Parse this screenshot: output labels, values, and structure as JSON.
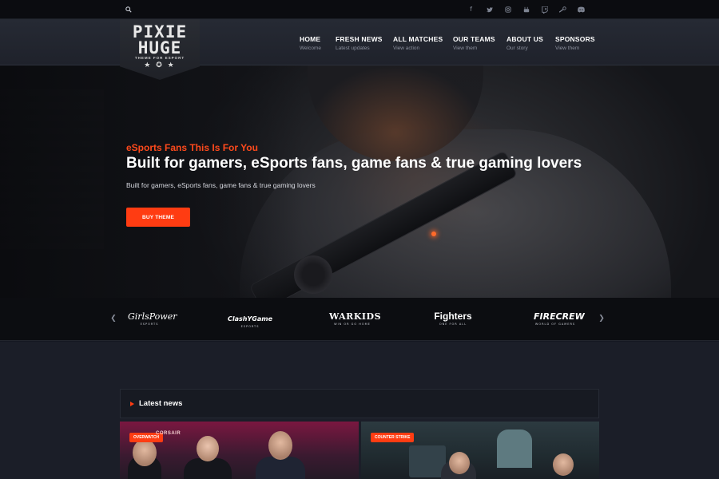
{
  "social": [
    "facebook-icon",
    "twitter-icon",
    "instagram-icon",
    "youtube-icon",
    "twitch-icon",
    "steam-icon",
    "discord-icon"
  ],
  "logo": {
    "line1": "PIXIE",
    "line2": "HUGE",
    "tagline": "THEME FOR ESPORT"
  },
  "nav": [
    {
      "label": "HOME",
      "sub": "Welcome"
    },
    {
      "label": "FRESH NEWS",
      "sub": "Latest updates"
    },
    {
      "label": "ALL MATCHES",
      "sub": "View action"
    },
    {
      "label": "OUR TEAMS",
      "sub": "View them"
    },
    {
      "label": "ABOUT US",
      "sub": "Our story"
    },
    {
      "label": "SPONSORS",
      "sub": "View them"
    }
  ],
  "hero": {
    "kicker": "eSports Fans This Is For You",
    "title": "Built for gamers, eSports fans, game fans & true gaming lovers",
    "description": "Built for gamers, eSports fans, game fans & true gaming lovers",
    "button": "BUY THEME"
  },
  "sponsors": [
    {
      "name": "GirlsPower",
      "sub": "ESPORTS"
    },
    {
      "name": "ClashYGame",
      "sub": "ESPORTS"
    },
    {
      "name": "WARKIDS",
      "sub": "WIN OR GO HOME"
    },
    {
      "name": "Fighters",
      "sub": "ONE FOR ALL"
    },
    {
      "name": "FIRECREW",
      "sub": "WORLD OF GAMERS"
    }
  ],
  "latest_news": {
    "heading": "Latest news",
    "cards": [
      {
        "category": "OVERWATCH",
        "banner": "CORSAIR"
      },
      {
        "category": "COUNTER STRIKE"
      }
    ]
  },
  "colors": {
    "accent": "#ff3c12",
    "background": "#1b1e28",
    "header": "#23262f"
  }
}
